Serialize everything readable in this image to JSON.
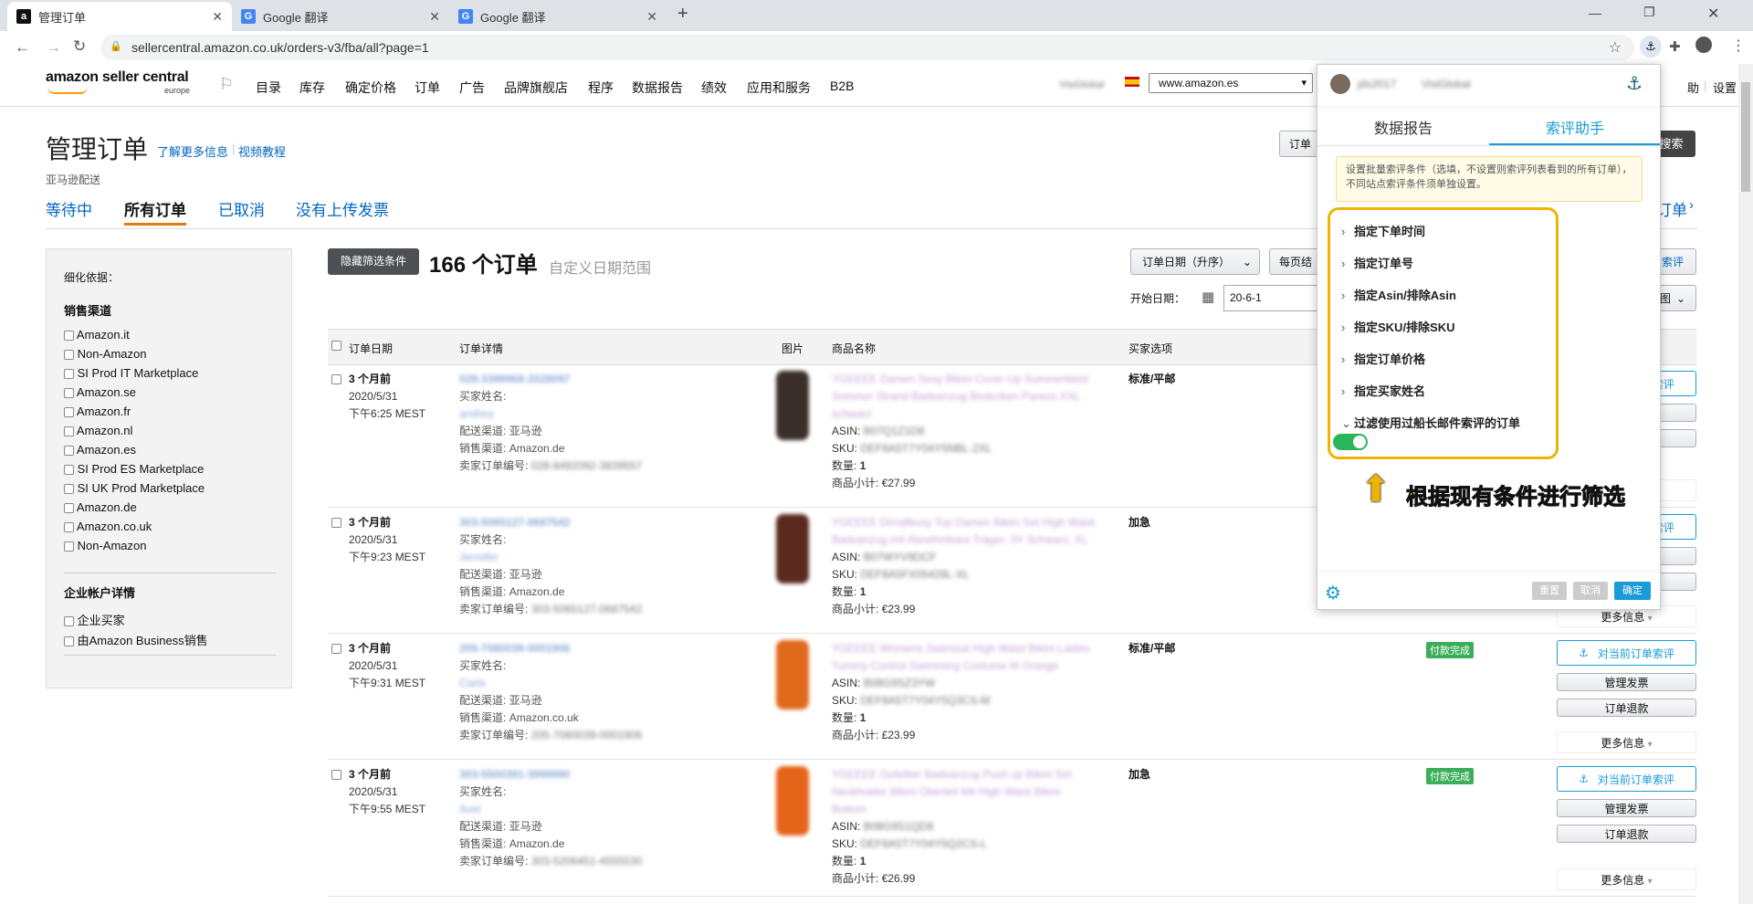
{
  "browser": {
    "tabs": [
      {
        "title": "管理订单",
        "icon": "amazon-favicon",
        "active": true
      },
      {
        "title": "Google 翻译",
        "icon": "google-translate-favicon",
        "active": false
      },
      {
        "title": "Google 翻译",
        "icon": "google-translate-favicon",
        "active": false
      }
    ],
    "new_tab": "+",
    "url": "sellercentral.amazon.co.uk/orders-v3/fba/all?page=1"
  },
  "header": {
    "logo_main": "amazon seller central",
    "logo_sub": "europe",
    "nav": [
      "目录",
      "库存",
      "确定价格",
      "订单",
      "广告",
      "品牌旗舰店",
      "程序",
      "数据报告",
      "绩效",
      "应用和服务",
      "B2B"
    ],
    "user_blurred": "VisiGlobal",
    "marketplace": "www.amazon.es",
    "right_links": [
      "助",
      "设置"
    ]
  },
  "page": {
    "title": "管理订单",
    "learn_more": "了解更多信息",
    "video": "视频教程",
    "subtitle": "亚马逊配送",
    "tabs": [
      "等待中",
      "所有订单",
      "已取消",
      "没有上传发票"
    ],
    "active_tab": "所有订单",
    "right_link": "订单"
  },
  "filters": {
    "refine_label": "细化依据：",
    "channel_heading": "销售渠道",
    "channels": [
      "Amazon.it",
      "Non-Amazon",
      "SI Prod IT Marketplace",
      "Amazon.se",
      "Amazon.fr",
      "Amazon.nl",
      "Amazon.es",
      "SI Prod ES Marketplace",
      "SI UK Prod Marketplace",
      "Amazon.de",
      "Amazon.co.uk",
      "Non-Amazon"
    ],
    "business_heading": "企业帐户详情",
    "business": [
      "企业买家",
      "由Amazon Business销售"
    ]
  },
  "orders_toolbar": {
    "hide_filters": "隐藏筛选条件",
    "count_text": "166 个订单",
    "range_text": "自定义日期范围",
    "sort_label": "订单日期（升序）",
    "per_page": "每页结",
    "start_date_label": "开始日期：",
    "start_date_value": "20-6-1",
    "search_btn": "搜索",
    "order_search_partial": "订单",
    "view_partial": "图"
  },
  "table": {
    "headers": [
      "订单日期",
      "订单详情",
      "图片",
      "商品名称",
      "买家选项"
    ],
    "labels": {
      "buyer_name": "买家姓名:",
      "fulfillment": "配送渠道: 亚马逊",
      "sales_channel": "销售渠道:",
      "seller_order_id": "卖家订单编号:",
      "asin": "ASIN:",
      "sku": "SKU:",
      "qty": "数量:",
      "subtotal": "商品小计:"
    },
    "rows": [
      {
        "age": "3 个月前",
        "date": "2020/5/31",
        "time": "下午6:25 MEST",
        "order_id": "028-3399968-3328097",
        "buyer": "andrea",
        "channel": "Amazon.de",
        "seller_id": "028-8492092-3839557",
        "title_l1": "YGEEEE Damen Sexy Bikini Cover Up Summerkleid",
        "title_l2": "Sommer Strand Badeanzug Bedecken Pareos XXL",
        "title_l3": "schwarz",
        "asin": "B07Q1Z1D8",
        "sku": "DEF8A5T7Y04Y5NBL-2XL",
        "qty": "1",
        "price": "€27.99",
        "option": "标准/平邮",
        "badge": ""
      },
      {
        "age": "3 个月前",
        "date": "2020/5/31",
        "time": "下午9:23 MEST",
        "order_id": "303-5065127-0687542",
        "buyer": "Jennifer",
        "channel": "Amazon.de",
        "seller_id": "303-5065127-0687542",
        "title_l1": "YGEEEE Dirndlbusy Top Damen Bikini Set High Waist",
        "title_l2": "Badeanzug mit Abnehmbare Träger, 3Y Schwarz, XL",
        "title_l3": "",
        "asin": "B07WYV9DCF",
        "sku": "DEF8A5FX05428L-XL",
        "qty": "1",
        "price": "€23.99",
        "option": "加急",
        "badge": ""
      },
      {
        "age": "3 个月前",
        "date": "2020/5/31",
        "time": "下午9:31 MEST",
        "order_id": "205-7080039-0001906",
        "buyer": "Carla",
        "channel": "Amazon.co.uk",
        "seller_id": "205-7080039-0001906",
        "title_l1": "YGEEEE Womens Swimsuit High Waist Bikini Ladies",
        "title_l2": "Tummy Control Swimming Costume M Orange",
        "title_l3": "",
        "asin": "B08G9SZ3YW",
        "sku": "DEF8A5T7Y04Y5Q3CS-M",
        "qty": "1",
        "price": "£23.99",
        "option": "标准/平邮",
        "badge": "付款完成"
      },
      {
        "age": "3 个月前",
        "date": "2020/5/31",
        "time": "下午9:55 MEST",
        "order_id": "303-5500391-3999990",
        "buyer": "Axel",
        "channel": "Amazon.de",
        "seller_id": "303-5206451-4555530",
        "title_l1": "YGEEEE Gefellter Badeanzug Push up Bikini Set",
        "title_l2": "Neckholder Bikini Oberteil Mit High Waist Bikini",
        "title_l3": "Bottom",
        "asin": "B08G9S1QD8",
        "sku": "DEF8A5T7Y04Y5Q2CS-L",
        "qty": "1",
        "price": "€26.99",
        "option": "加急",
        "badge": "付款完成"
      }
    ],
    "right_actions": {
      "review": "对当前订单索评",
      "manage_invoice": "管理发票",
      "refund": "订单退款",
      "more": "更多信息"
    }
  },
  "panel": {
    "user_blurred": "jds2017",
    "shop_blurred": "VisiGlobal",
    "tabs": [
      "数据报告",
      "索评助手"
    ],
    "active_tab": "索评助手",
    "notice": "设置批量索评条件（选填，不设置则索评列表看到的所有订单），不同站点索评条件须单独设置。",
    "filters": [
      "指定下单时间",
      "指定订单号",
      "指定Asin/排除Asin",
      "指定SKU/排除SKU",
      "指定订单价格",
      "指定买家姓名",
      "过滤使用过船长邮件索评的订单"
    ],
    "toggle_on": true,
    "annotation": "根据现有条件进行筛选",
    "buttons": {
      "reset": "重置",
      "cancel": "取消",
      "confirm": "确定"
    },
    "colors": {
      "accent": "#1a9bd7",
      "highlight": "#f0b400",
      "toggle": "#2bb55a"
    }
  }
}
